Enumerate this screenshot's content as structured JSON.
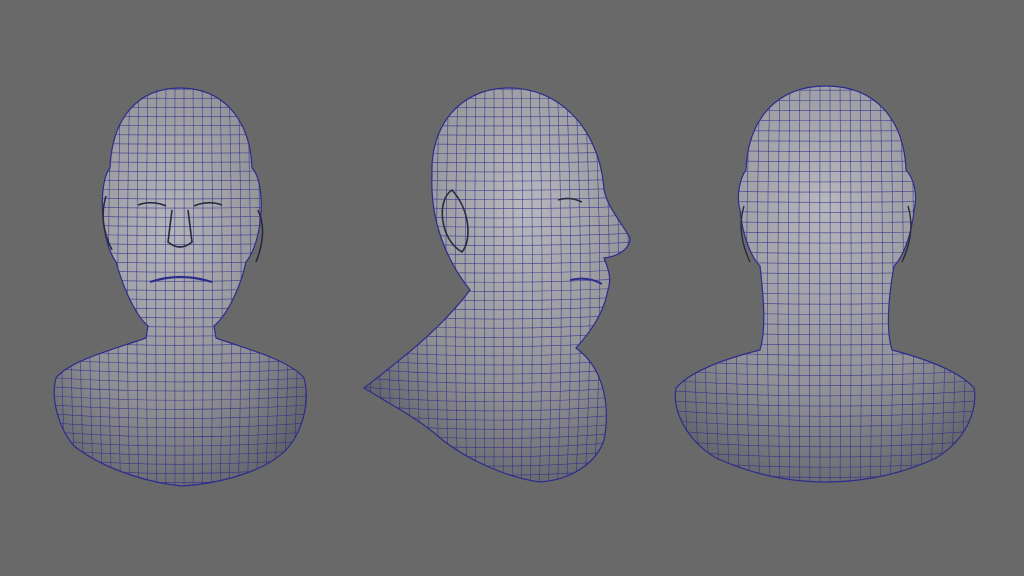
{
  "viewport": {
    "background_color": "#696969",
    "mesh_surface_color": "#8f8f94",
    "mesh_shadow_color": "#5e5e66",
    "mesh_highlight_color": "#b4b4ba",
    "wireframe_color": "#2c2c8c"
  },
  "models": [
    {
      "view": "front"
    },
    {
      "view": "three-quarter"
    },
    {
      "view": "back"
    }
  ]
}
